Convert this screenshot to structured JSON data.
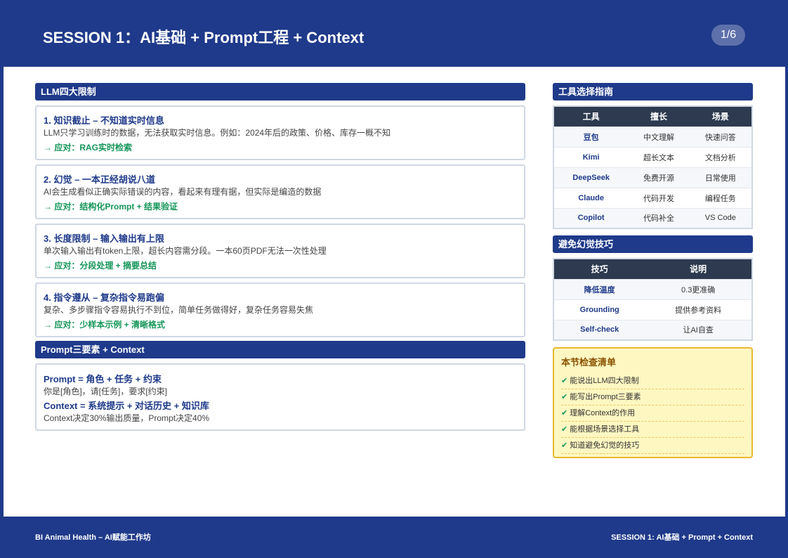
{
  "header": {
    "title": "SESSION 1：AI基础 + Prompt工程 + Context",
    "page": "1/6"
  },
  "limits": {
    "heading": "LLM四大限制",
    "items": [
      {
        "title": "1. 知识截止 – 不知道实时信息",
        "desc": "LLM只学习训练时的数据，无法获取实时信息。例如：2024年后的政策、价格、库存一概不知",
        "fix": "→ 应对：RAG实时检索"
      },
      {
        "title": "2. 幻觉 – 一本正经胡说八道",
        "desc": "AI会生成看似正确实际错误的内容，看起来有理有据，但实际是编造的数据",
        "fix": "→ 应对：结构化Prompt + 结果验证"
      },
      {
        "title": "3. 长度限制 – 输入输出有上限",
        "desc": "单次输入输出有token上限，超长内容需分段。一本60页PDF无法一次性处理",
        "fix": "→ 应对：分段处理 + 摘要总结"
      },
      {
        "title": "4. 指令遵从 – 复杂指令易跑偏",
        "desc": "复杂、多步骤指令容易执行不到位，简单任务做得好，复杂任务容易失焦",
        "fix": "→ 应对：少样本示例 + 清晰格式"
      }
    ]
  },
  "prompt": {
    "heading": "Prompt三要素 + Context",
    "line1": "Prompt = 角色 + 任务 + 约束",
    "line2": "你是[角色]，请[任务]，要求[约束]",
    "line3": "Context = 系统提示 + 对话历史 + 知识库",
    "line4": "Context决定30%输出质量，Prompt决定40%"
  },
  "tools": {
    "heading": "工具选择指南",
    "columns": [
      "工具",
      "擅长",
      "场景"
    ],
    "rows": [
      [
        "豆包",
        "中文理解",
        "快速问答"
      ],
      [
        "Kimi",
        "超长文本",
        "文档分析"
      ],
      [
        "DeepSeek",
        "免费开源",
        "日常使用"
      ],
      [
        "Claude",
        "代码开发",
        "编程任务"
      ],
      [
        "Copilot",
        "代码补全",
        "VS Code"
      ]
    ]
  },
  "tips": {
    "heading": "避免幻觉技巧",
    "columns": [
      "技巧",
      "说明"
    ],
    "rows": [
      [
        "降低温度",
        "0.3更准确"
      ],
      [
        "Grounding",
        "提供参考资料"
      ],
      [
        "Self-check",
        "让AI自查"
      ]
    ]
  },
  "checklist": {
    "title": "本节检查清单",
    "mark": "✔",
    "items": [
      "能说出LLM四大限制",
      "能写出Prompt三要素",
      "理解Context的作用",
      "能根据场景选择工具",
      "知道避免幻觉的技巧"
    ]
  },
  "footer": {
    "left": "BI Animal Health – AI赋能工作坊",
    "right": "SESSION 1: AI基础 + Prompt + Context"
  }
}
